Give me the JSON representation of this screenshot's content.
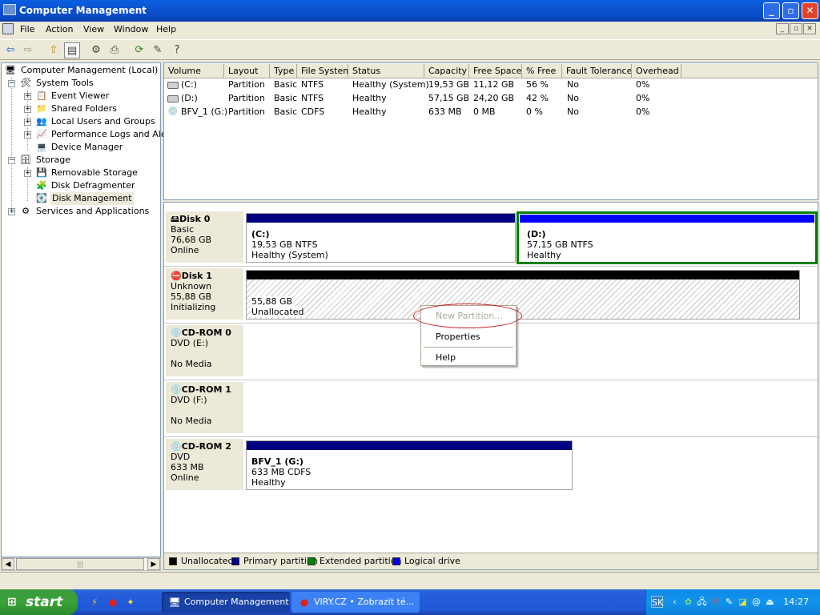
{
  "window": {
    "title": "Computer Management",
    "minimize": "_",
    "maximize": "▫",
    "close": "✕"
  },
  "menu": [
    "File",
    "Action",
    "View",
    "Window",
    "Help"
  ],
  "mdi_controls": [
    "_",
    "▫",
    "✕"
  ],
  "toolbar_icons": [
    "back-arrow-icon",
    "forward-arrow-icon",
    "up-folder-icon",
    "show-hide-tree-icon",
    "properties-icon",
    "export-list-icon",
    "refresh-icon",
    "settings-icon",
    "help-icon"
  ],
  "toolbar": {
    "back": "⇦",
    "forward": "⇨",
    "up": "⇧",
    "tree": "▤",
    "props": "⚙",
    "export": "⎙",
    "refresh": "⟳",
    "settings": "✎",
    "help": "?"
  },
  "tree": {
    "root": "Computer Management (Local)",
    "system_tools": "System Tools",
    "event_viewer": "Event Viewer",
    "shared_folders": "Shared Folders",
    "local_users": "Local Users and Groups",
    "perf_logs": "Performance Logs and Alerts",
    "device_manager": "Device Manager",
    "storage": "Storage",
    "removable_storage": "Removable Storage",
    "disk_defrag": "Disk Defragmenter",
    "disk_management": "Disk Management",
    "services": "Services and Applications"
  },
  "volumes": {
    "columns": [
      "Volume",
      "Layout",
      "Type",
      "File System",
      "Status",
      "Capacity",
      "Free Space",
      "% Free",
      "Fault Tolerance",
      "Overhead"
    ],
    "rows": [
      [
        "(C:)",
        "Partition",
        "Basic",
        "NTFS",
        "Healthy (System)",
        "19,53 GB",
        "11,12 GB",
        "56 %",
        "No",
        "0%"
      ],
      [
        "(D:)",
        "Partition",
        "Basic",
        "NTFS",
        "Healthy",
        "57,15 GB",
        "24,20 GB",
        "42 %",
        "No",
        "0%"
      ],
      [
        "BFV_1 (G:)",
        "Partition",
        "Basic",
        "CDFS",
        "Healthy",
        "633 MB",
        "0 MB",
        "0 %",
        "No",
        "0%"
      ]
    ]
  },
  "disks": {
    "disk0": {
      "name": "Disk 0",
      "type": "Basic",
      "size": "76,68 GB",
      "state": "Online",
      "c": {
        "label": "(C:)",
        "size": "19,53 GB NTFS",
        "status": "Healthy (System)"
      },
      "d": {
        "label": "(D:)",
        "size": "57,15 GB NTFS",
        "status": "Healthy"
      }
    },
    "disk1": {
      "name": "Disk 1",
      "type": "Unknown",
      "size": "55,88 GB",
      "state": "Initializing",
      "un": {
        "size": "55,88 GB",
        "status": "Unallocated"
      }
    },
    "cd0": {
      "name": "CD-ROM 0",
      "type": "DVD (E:)",
      "state": "No Media"
    },
    "cd1": {
      "name": "CD-ROM 1",
      "type": "DVD (F:)",
      "state": "No Media"
    },
    "cd2": {
      "name": "CD-ROM 2",
      "type": "DVD",
      "size": "633 MB",
      "state": "Online",
      "g": {
        "label": "BFV_1  (G:)",
        "size": "633 MB CDFS",
        "status": "Healthy"
      }
    }
  },
  "legend": {
    "unallocated": "Unallocated",
    "primary": "Primary partition",
    "extended": "Extended partition",
    "logical": "Logical drive",
    "colors": {
      "unallocated": "#000000",
      "primary": "#000080",
      "extended": "#008000",
      "logical": "#0000FF"
    }
  },
  "context_menu": {
    "new_partition": "New Partition...",
    "properties": "Properties",
    "help": "Help"
  },
  "taskbar": {
    "start": "start",
    "task1": "Computer Management",
    "task2": "VIRY.CZ • Zobrazit té...",
    "lang": "SK",
    "clock": "14:27"
  }
}
